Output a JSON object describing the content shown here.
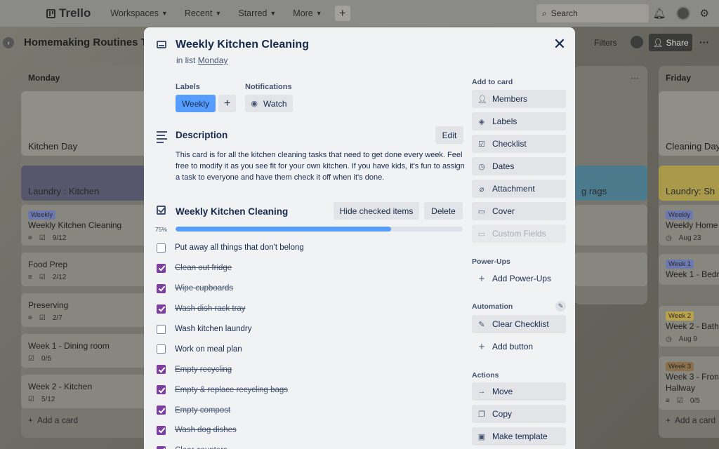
{
  "topnav": {
    "logo": "Trello",
    "menu": [
      "Workspaces",
      "Recent",
      "Starred",
      "More"
    ],
    "search_placeholder": "Search"
  },
  "board": {
    "title": "Homemaking Routines Tı",
    "filters": "Filters",
    "share": "Share"
  },
  "lists": {
    "monday": {
      "title": "Monday",
      "cover": "Kitchen Day",
      "colored": "Laundry : Kitchen",
      "cards": [
        {
          "badge": "Weekly",
          "title": "Weekly Kitchen Cleaning",
          "meta": "9/12"
        },
        {
          "title": "Food Prep",
          "meta": "2/12"
        },
        {
          "title": "Preserving",
          "meta": "2/7"
        },
        {
          "title": "Week 1 - Dining room",
          "meta": "0/5"
        },
        {
          "title": "Week 2 - Kitchen",
          "meta": "5/12"
        }
      ],
      "add": "Add a card"
    },
    "middle": {
      "colored": "g rags"
    },
    "friday": {
      "title": "Friday",
      "cover": "Cleaning Day",
      "colored": "Laundry: Sh",
      "cards": [
        {
          "badge": "Weekly",
          "title": "Weekly Home I",
          "meta": "Aug 23"
        },
        {
          "badge": "Week 1",
          "title": "Week 1 - Bedro"
        },
        {
          "badge": "Week 2",
          "title": "Week 2 - Bath",
          "meta": "Aug 9"
        },
        {
          "badge": "Week 3",
          "title": "Week 3 - Front",
          "title2": "Hallway",
          "meta": "0/5"
        }
      ],
      "add": "Add a card"
    }
  },
  "modal": {
    "title": "Weekly Kitchen Cleaning",
    "in_list_prefix": "in list",
    "in_list_name": "Monday",
    "labels_heading": "Labels",
    "label_value": "Weekly",
    "notifications_heading": "Notifications",
    "watch": "Watch",
    "description_heading": "Description",
    "edit": "Edit",
    "description": "This card is for all the kitchen cleaning tasks that need to get done every week. Feel free to modify it as you see fit for your own kitchen. If you have kids, it's fun to assign a task to everyone and have them check it off when it's done.",
    "checklist": {
      "title": "Weekly Kitchen Cleaning",
      "hide_checked": "Hide checked items",
      "delete": "Delete",
      "percent_label": "75%",
      "progress": 0.75,
      "items": [
        {
          "text": "Put away all things that don't belong",
          "checked": false
        },
        {
          "text": "Clean out fridge",
          "checked": true
        },
        {
          "text": "Wipe cupboards",
          "checked": true
        },
        {
          "text": "Wash dish rack tray",
          "checked": true
        },
        {
          "text": "Wash kitchen laundry",
          "checked": false
        },
        {
          "text": "Work on meal plan",
          "checked": false
        },
        {
          "text": "Empty recycling",
          "checked": true
        },
        {
          "text": "Empty & replace recycling bags",
          "checked": true
        },
        {
          "text": "Empty compost",
          "checked": true
        },
        {
          "text": "Wash dog dishes",
          "checked": true
        },
        {
          "text": "Clear counters",
          "checked": true
        }
      ]
    },
    "sidebar": {
      "add_to_card": "Add to card",
      "members": "Members",
      "labels": "Labels",
      "checklist": "Checklist",
      "dates": "Dates",
      "attachment": "Attachment",
      "cover": "Cover",
      "custom_fields": "Custom Fields",
      "power_ups": "Power-Ups",
      "add_power_ups": "Add Power-Ups",
      "automation": "Automation",
      "clear_checklist": "Clear Checklist",
      "add_button": "Add button",
      "actions": "Actions",
      "move": "Move",
      "copy": "Copy",
      "make_template": "Make template"
    }
  },
  "colors": {
    "label_blue": "#579dff",
    "checkbox_purple": "#7c3fa0",
    "modal_bg": "#f1f2f4"
  }
}
